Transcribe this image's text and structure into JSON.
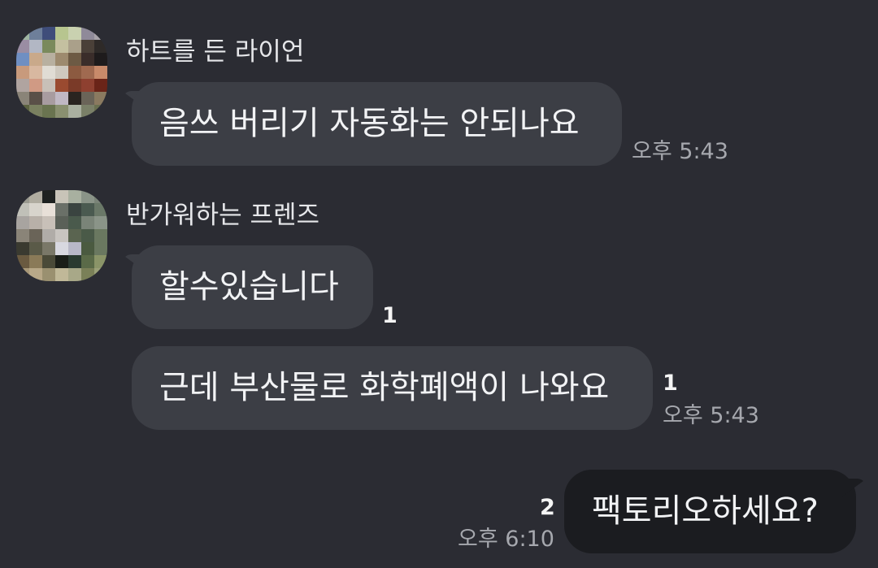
{
  "messages": [
    {
      "sender": "하트를 든 라이언",
      "text": "음쓰 버리기 자동화는 안되나요",
      "time": "오후 5:43"
    },
    {
      "sender": "반가워하는 프렌즈",
      "text": "할수있습니다",
      "unread": "1"
    },
    {
      "text": "근데 부산물로 화학폐액이 나와요",
      "unread": "1",
      "time": "오후 5:43"
    },
    {
      "text": "팩토리오하세요?",
      "unread": "2",
      "time": "오후 6:10",
      "outgoing": true
    }
  ],
  "colors": {
    "background": "#2b2c33",
    "incoming_bubble": "#3c3e45",
    "outgoing_bubble": "#1b1c20",
    "time_text": "#a6a8ae"
  }
}
